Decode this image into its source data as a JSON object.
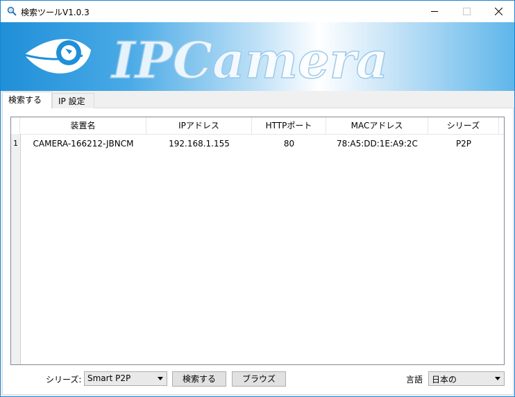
{
  "window": {
    "title": "検索ツールV1.0.3"
  },
  "banner": {
    "logo_text": "IPCamera"
  },
  "tabs": [
    {
      "label": "検索する",
      "active": true
    },
    {
      "label": "IP 設定",
      "active": false
    }
  ],
  "table": {
    "columns": [
      "装置名",
      "IPアドレス",
      "HTTPポート",
      "MACアドレス",
      "シリーズ"
    ],
    "rows": [
      {
        "num": "1",
        "device_name": "CAMERA-166212-JBNCM",
        "ip": "192.168.1.155",
        "http_port": "80",
        "mac": "78:A5:DD:1E:A9:2C",
        "series": "P2P"
      }
    ]
  },
  "controls": {
    "series_label": "シリーズ:",
    "series_value": "Smart P2P",
    "search_button": "検索する",
    "browse_button": "ブラウズ",
    "language_label": "言語",
    "language_value": "日本の"
  },
  "colors": {
    "titlebar_border": "#1883d7",
    "banner_blue": "#1f8fd8"
  }
}
